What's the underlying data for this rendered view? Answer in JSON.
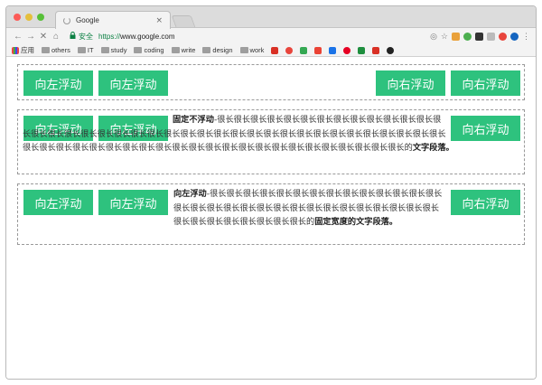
{
  "browser": {
    "tab_title": "Google",
    "tab_close": "×",
    "nav_back": "←",
    "nav_forward": "→",
    "nav_stop": "✕",
    "nav_home": "⌂",
    "secure_label": "安全",
    "url_scheme": "https://",
    "url_host": "www.google.com"
  },
  "bookmarks": [
    {
      "label": "应用",
      "icon": "apps-icon"
    },
    {
      "label": "others",
      "icon": "folder-icon"
    },
    {
      "label": "IT",
      "icon": "folder-icon"
    },
    {
      "label": "study",
      "icon": "folder-icon"
    },
    {
      "label": "coding",
      "icon": "folder-icon"
    },
    {
      "label": "write",
      "icon": "folder-icon"
    },
    {
      "label": "design",
      "icon": "folder-icon"
    },
    {
      "label": "work",
      "icon": "folder-icon"
    }
  ],
  "colors": {
    "button_green": "#2ec27e",
    "border_gray": "#999999"
  },
  "section1": {
    "left_buttons": [
      "向左浮动",
      "向左浮动"
    ],
    "right_buttons": [
      "向右浮动",
      "向右浮动"
    ]
  },
  "section2": {
    "left_buttons": [
      "向左浮动",
      "向左浮动"
    ],
    "right_button": "向右浮动",
    "bold_lead": "固定不浮动",
    "body": "-很长很长很长很长很长很长很长很长很长很长很长很长很长很长很长很长很长很长很长很长很长很长很长很长很长很长很长很长很长很长很长很长很长很长很长很长很长很长很长很长很长很长很长很长很长很长很长很长很长很长很长很长很长很长很长很长很长很长很长很长很长很长的",
    "bold_tail": "文字段落。"
  },
  "section3": {
    "left_buttons": [
      "向左浮动",
      "向左浮动"
    ],
    "right_button": "向右浮动",
    "bold_lead": "向左浮动",
    "body": "-很长很长很长很长很长很长很长很长很长很长很长很长很长很长很长很长很长很长很长很长很长很长很长很长很长很长很长很长很长很长很长很长很长很长很长很长很长很长的",
    "bold_tail": "固定宽度的文字段落。"
  }
}
